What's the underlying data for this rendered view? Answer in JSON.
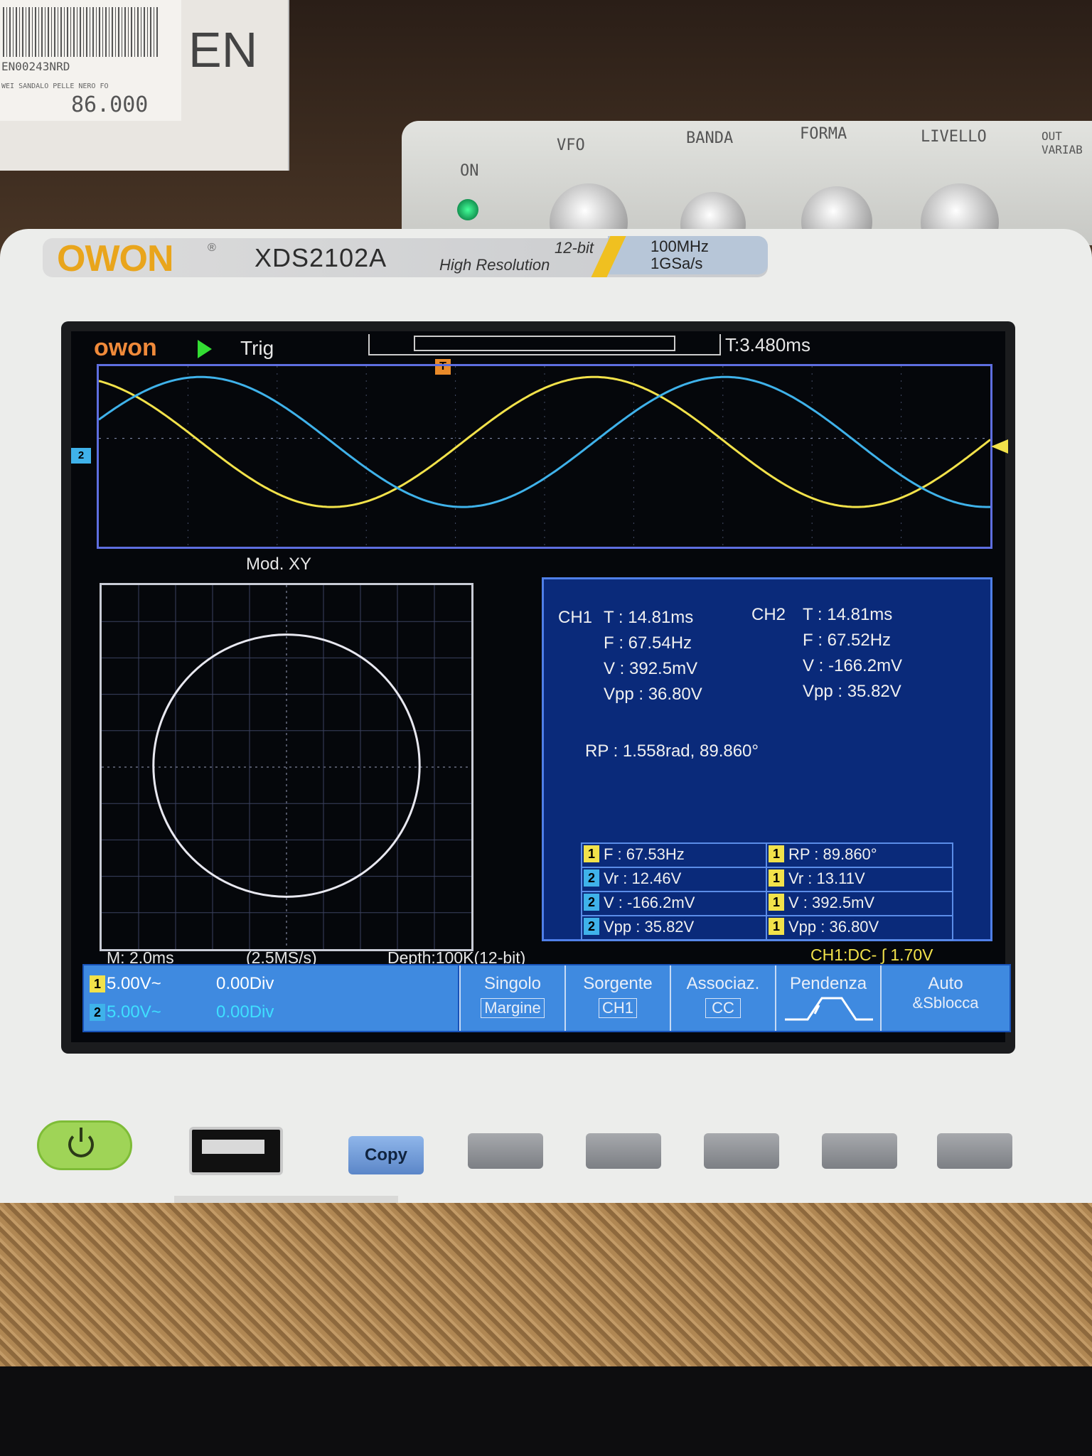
{
  "background": {
    "box_code": "EN00243NRD",
    "box_desc": "WEI SANDALO PELLE NERO FO",
    "box_price": "86.000",
    "box_brand": "EN",
    "generator_labels": [
      "ON",
      "VFO",
      "BANDA",
      "FORMA",
      "LIVELLO",
      "OUT VARIAB"
    ]
  },
  "device": {
    "brand": "OWON",
    "model": "XDS2102A",
    "bits": "12-bit",
    "resolution": "High Resolution",
    "bandwidth": "100MHz",
    "sample_rate": "1GSa/s"
  },
  "screen": {
    "logo": "owon",
    "trigger_state": "Trig",
    "trigger_time": "T:3.480ms",
    "trigger_marker": "T",
    "ch2_marker": "2",
    "xy_title": "Mod. XY",
    "measure": {
      "ch1": {
        "label": "CH1",
        "T": "T : 14.81ms",
        "F": "F : 67.54Hz",
        "V": "V : 392.5mV",
        "Vpp": "Vpp : 36.80V"
      },
      "ch2": {
        "label": "CH2",
        "T": "T : 14.81ms",
        "F": "F : 67.52Hz",
        "V": "V : -166.2mV",
        "Vpp": "Vpp : 35.82V"
      },
      "rp": "RP : 1.558rad, 89.860°",
      "table": [
        {
          "ch": "1",
          "text": "F : 67.53Hz"
        },
        {
          "ch": "1",
          "text": "RP : 89.860°"
        },
        {
          "ch": "2",
          "text": "Vr : 12.46V"
        },
        {
          "ch": "1",
          "text": "Vr : 13.11V"
        },
        {
          "ch": "2",
          "text": "V : -166.2mV"
        },
        {
          "ch": "1",
          "text": "V : 392.5mV"
        },
        {
          "ch": "2",
          "text": "Vpp : 35.82V"
        },
        {
          "ch": "1",
          "text": "Vpp : 36.80V"
        }
      ]
    },
    "status": {
      "timebase": "M: 2.0ms",
      "srate": "(2.5MS/s)",
      "depth": "Depth:100K(12-bit)",
      "trigger": "CH1:DC- ∫ 1.70V"
    },
    "channels": [
      {
        "num": "1",
        "scale": "5.00V~",
        "offset": "0.00Div"
      },
      {
        "num": "2",
        "scale": "5.00V~",
        "offset": "0.00Div"
      }
    ],
    "menu": [
      {
        "label": "Singolo",
        "value": "Margine"
      },
      {
        "label": "Sorgente",
        "value": "CH1"
      },
      {
        "label": "Associaz.",
        "value": "CC"
      },
      {
        "label": "Pendenza",
        "value": ""
      },
      {
        "label": "Auto",
        "value": "&Sblocca"
      }
    ]
  },
  "panel": {
    "copy_label": "Copy"
  },
  "colors": {
    "ch1": "#f2e24a",
    "ch2": "#3fb2ea",
    "grid": "#c9ccd6",
    "menu": "#3f8ae0"
  }
}
